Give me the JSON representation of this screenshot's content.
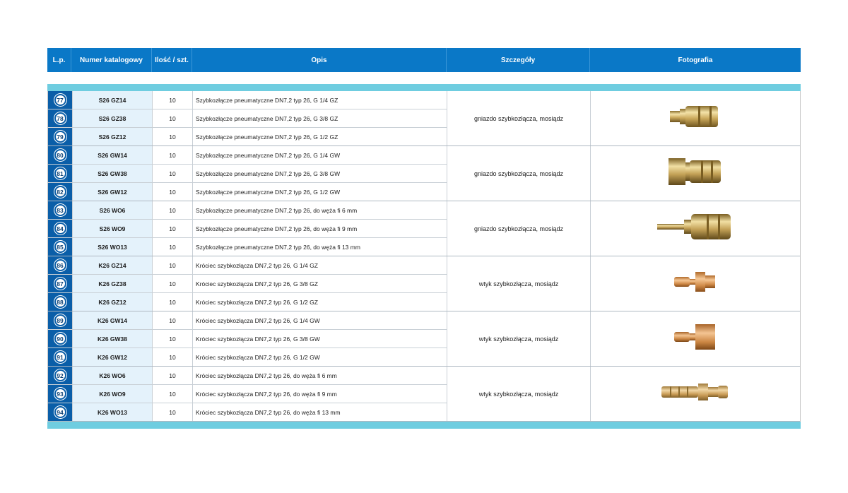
{
  "header": {
    "lp": "L.p.",
    "num": "Numer katalogowy",
    "qty": "Ilość / szt.",
    "desc": "Opis",
    "details": "Szczegóły",
    "photo": "Fotografia"
  },
  "colors": {
    "header_bg": "#0a78c7",
    "band": "#6fcde0",
    "lp_bg": "#0a5ea8",
    "num_bg": "#e4f2fb"
  },
  "groups": [
    {
      "details": "gniazdo szybkozłącza, mosiądz",
      "photo_icon": "socket-coupler-male-thread-icon",
      "rows": [
        {
          "lp": "77",
          "num": "S26 GZ14",
          "qty": "10",
          "desc": "Szybkozłącze pneumatyczne DN7,2 typ 26, G 1/4 GZ"
        },
        {
          "lp": "78",
          "num": "S26 GZ38",
          "qty": "10",
          "desc": "Szybkozłącze pneumatyczne DN7,2 typ 26, G 3/8 GZ"
        },
        {
          "lp": "79",
          "num": "S26 GZ12",
          "qty": "10",
          "desc": "Szybkozłącze pneumatyczne DN7,2 typ 26, G 1/2 GZ"
        }
      ]
    },
    {
      "details": "gniazdo szybkozłącza, mosiądz",
      "photo_icon": "socket-coupler-female-thread-icon",
      "rows": [
        {
          "lp": "80",
          "num": "S26 GW14",
          "qty": "10",
          "desc": "Szybkozłącze pneumatyczne DN7,2 typ 26, G 1/4 GW"
        },
        {
          "lp": "81",
          "num": "S26 GW38",
          "qty": "10",
          "desc": "Szybkozłącze pneumatyczne DN7,2 typ 26, G 3/8 GW"
        },
        {
          "lp": "82",
          "num": "S26 GW12",
          "qty": "10",
          "desc": "Szybkozłącze pneumatyczne DN7,2 typ 26, G 1/2 GW"
        }
      ]
    },
    {
      "details": "gniazdo szybkozłącza, mosiądz",
      "photo_icon": "socket-coupler-hose-barb-icon",
      "rows": [
        {
          "lp": "83",
          "num": "S26 WO6",
          "qty": "10",
          "desc": "Szybkozłącze pneumatyczne DN7,2 typ 26, do węża fi 6 mm"
        },
        {
          "lp": "84",
          "num": "S26 WO9",
          "qty": "10",
          "desc": "Szybkozłącze pneumatyczne DN7,2 typ 26, do węża fi 9 mm"
        },
        {
          "lp": "85",
          "num": "S26 WO13",
          "qty": "10",
          "desc": "Szybkozłącze pneumatyczne DN7,2 typ 26, do węża fi 13 mm"
        }
      ]
    },
    {
      "details": "wtyk szybkozłącza, mosiądz",
      "photo_icon": "plug-male-thread-icon",
      "rows": [
        {
          "lp": "86",
          "num": "K26 GZ14",
          "qty": "10",
          "desc": "Króciec szybkozłącza DN7,2 typ 26, G 1/4 GZ"
        },
        {
          "lp": "87",
          "num": "K26 GZ38",
          "qty": "10",
          "desc": "Króciec szybkozłącza DN7,2 typ 26, G 3/8 GZ"
        },
        {
          "lp": "88",
          "num": "K26 GZ12",
          "qty": "10",
          "desc": "Króciec szybkozłącza DN7,2 typ 26, G 1/2 GZ"
        }
      ]
    },
    {
      "details": "wtyk szybkozłącza, mosiądz",
      "photo_icon": "plug-female-thread-icon",
      "rows": [
        {
          "lp": "89",
          "num": "K26 GW14",
          "qty": "10",
          "desc": "Króciec szybkozłącza DN7,2 typ 26, G 1/4 GW"
        },
        {
          "lp": "90",
          "num": "K26 GW38",
          "qty": "10",
          "desc": "Króciec szybkozłącza DN7,2 typ 26, G 3/8 GW"
        },
        {
          "lp": "91",
          "num": "K26 GW12",
          "qty": "10",
          "desc": "Króciec szybkozłącza DN7,2 typ 26, G 1/2 GW"
        }
      ]
    },
    {
      "details": "wtyk szybkozłącza, mosiądz",
      "photo_icon": "plug-hose-barb-icon",
      "rows": [
        {
          "lp": "92",
          "num": "K26 WO6",
          "qty": "10",
          "desc": "Króciec szybkozłącza DN7,2 typ 26, do węża fi 6 mm"
        },
        {
          "lp": "93",
          "num": "K26 WO9",
          "qty": "10",
          "desc": "Króciec szybkozłącza DN7,2 typ 26, do węża fi 9 mm"
        },
        {
          "lp": "94",
          "num": "K26 WO13",
          "qty": "10",
          "desc": "Króciec szybkozłącza DN7,2 typ 26, do węża fi 13 mm"
        }
      ]
    }
  ]
}
